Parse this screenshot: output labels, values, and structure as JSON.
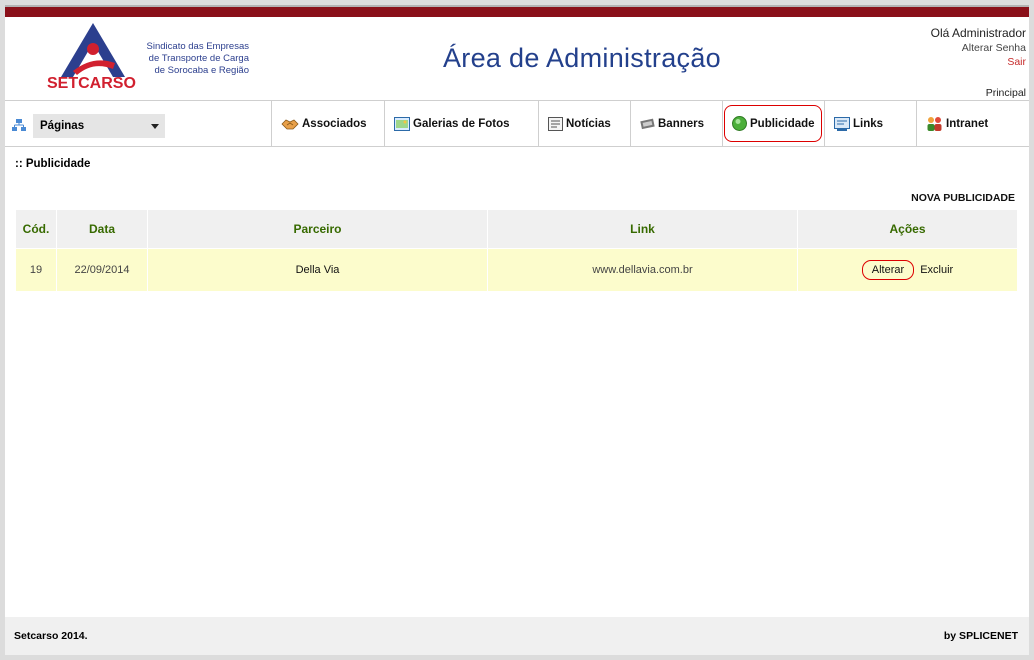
{
  "header": {
    "logo_text": "SETCARSO",
    "tagline_lines": [
      "Sindicato das Empresas",
      "de Transporte de Carga",
      "de Sorocaba e Região"
    ],
    "title": "Área de Administração",
    "greeting": "Olá Administrador",
    "change_password": "Alterar Senha",
    "logout": "Sair",
    "principal": "Principal"
  },
  "menu": {
    "pages_select": {
      "value": "Páginas"
    },
    "items": [
      {
        "label": "Associados",
        "icon": "handshake-icon"
      },
      {
        "label": "Galerias de Fotos",
        "icon": "photo-gallery-icon"
      },
      {
        "label": "Notícias",
        "icon": "news-icon"
      },
      {
        "label": "Banners",
        "icon": "banner-icon"
      },
      {
        "label": "Publicidade",
        "icon": "green-circle-icon"
      },
      {
        "label": "Links",
        "icon": "links-icon"
      },
      {
        "label": "Intranet",
        "icon": "people-icon"
      }
    ]
  },
  "content": {
    "breadcrumb": ":: Publicidade",
    "new_link": "NOVA PUBLICIDADE",
    "table": {
      "columns": [
        "Cód.",
        "Data",
        "Parceiro",
        "Link",
        "Ações"
      ],
      "rows": [
        {
          "code": "19",
          "date": "22/09/2014",
          "partner": "Della Via",
          "link": "www.dellavia.com.br",
          "edit": "Alterar",
          "delete": "Excluir"
        }
      ]
    }
  },
  "footer": {
    "left": "Setcarso 2014.",
    "right": "by SPLICENET"
  },
  "colors": {
    "topbar": "#8a1019",
    "title": "#23408c",
    "header_text_green": "#376a00",
    "row_bg": "#fcfccc",
    "highlight_red": "#dd0000"
  }
}
